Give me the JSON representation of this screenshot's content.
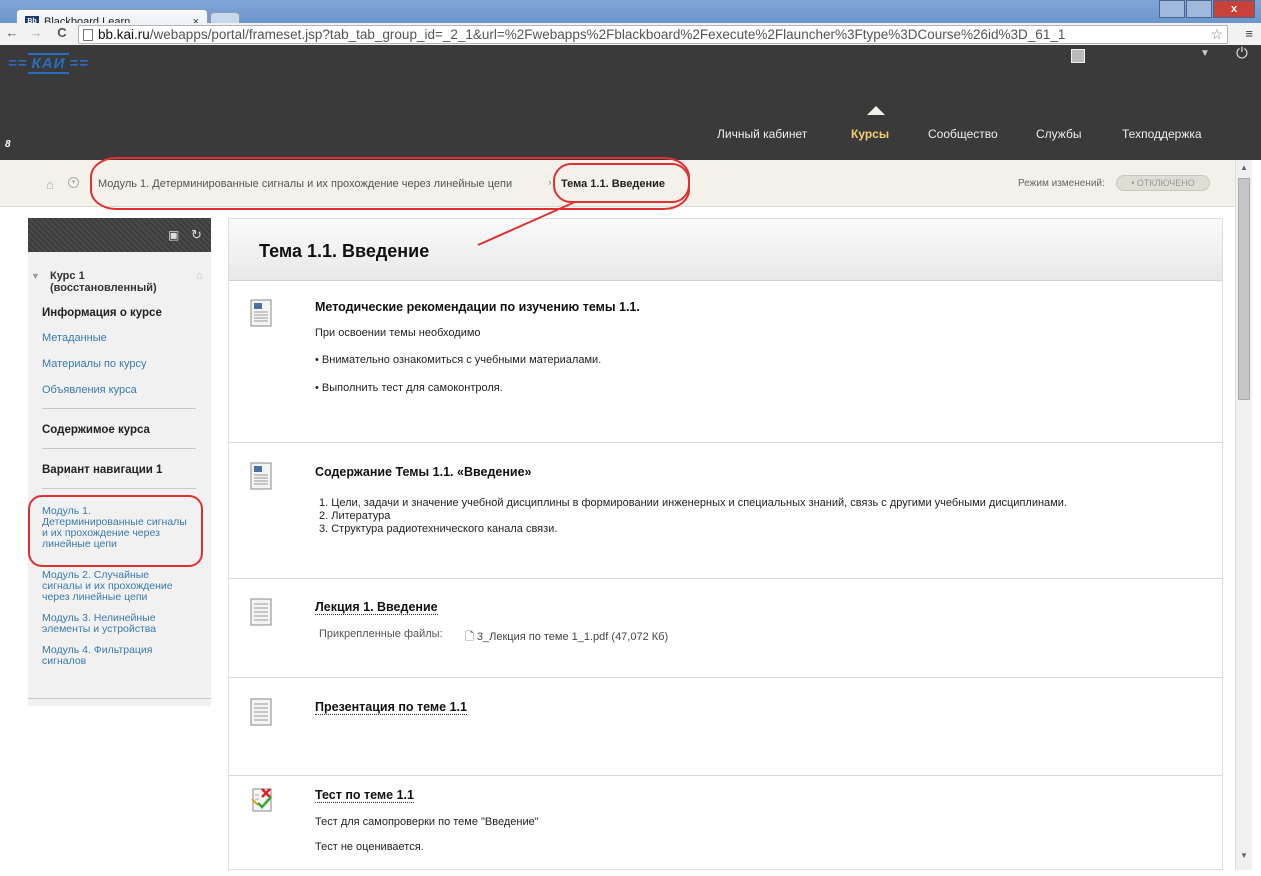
{
  "browser": {
    "tab_title": "Blackboard Learn",
    "tab_close": "×",
    "url_domain": "bb.kai.ru",
    "url_rest": "/webapps/portal/frameset.jsp?tab_tab_group_id=_2_1&url=%2Fwebapps%2Fblackboard%2Fexecute%2Flauncher%3Ftype%3DCourse%26id%3D_61_1",
    "nav_back": "←",
    "nav_forward": "→",
    "nav_reload": "C",
    "star": "☆",
    "menu": "≡",
    "win_close": "x"
  },
  "header": {
    "logo": "КАИ",
    "edit_mode_icon": "8",
    "tabs": [
      "Личный кабинет",
      "Курсы",
      "Сообщество",
      "Службы",
      "Техподдержка"
    ],
    "active_tab": "Курсы"
  },
  "breadcrumb": {
    "crumb1": "Модуль 1. Детерминированные сигналы и их прохождение через линейные цепи",
    "separator": "›",
    "crumb2": "Тема 1.1. Введение",
    "mode_label": "Режим изменений:",
    "mode_value": "• ОТКЛЮЧЕНО"
  },
  "sidebar": {
    "course": "Курс 1 (восстановленный)",
    "items": {
      "info": "Информация о курсе",
      "meta": "Метаданные",
      "materials": "Материалы по курсу",
      "announcements": "Объявления курса",
      "contents": "Содержимое курса",
      "variant": "Вариант навигации 1",
      "mod1": "Модуль 1. Детерминированные сигналы и их прохождение через линейные цепи",
      "mod2": "Модуль 2. Случайные сигналы и их прохождение через линейные цепи",
      "mod3": "Модуль 3. Нелинейные элементы и устройства",
      "mod4": "Модуль 4. Фильтрация сигналов"
    }
  },
  "main": {
    "title": "Тема 1.1. Введение",
    "items": [
      {
        "heading": "Методические рекомендации по изучению темы 1.1.",
        "lines": [
          "При освоении темы  необходимо",
          "• Внимательно ознакомиться с учебными материалами.",
          "• Выполнить тест для самоконтроля."
        ]
      },
      {
        "heading": "Содержание Темы 1.1. «Введение»",
        "list": [
          "1.  Цели, задачи и значение учебной дисциплины в формировании инженерных и специальных знаний, связь с другими учебными дисциплинами.",
          "2.  Литература",
          "3.  Структура радиотехнического канала связи."
        ]
      },
      {
        "heading": "Лекция 1. Введение",
        "attach_label": "Прикрепленные файлы:",
        "attach_file": "3_Лекция по теме 1_1.pdf (47,072 Кб)"
      },
      {
        "heading": "Презентация по теме 1.1"
      },
      {
        "heading": "Тест по теме 1.1",
        "lines": [
          "Тест для самопроверки по теме \"Введение\"",
          "Тест не оценивается."
        ]
      }
    ]
  }
}
